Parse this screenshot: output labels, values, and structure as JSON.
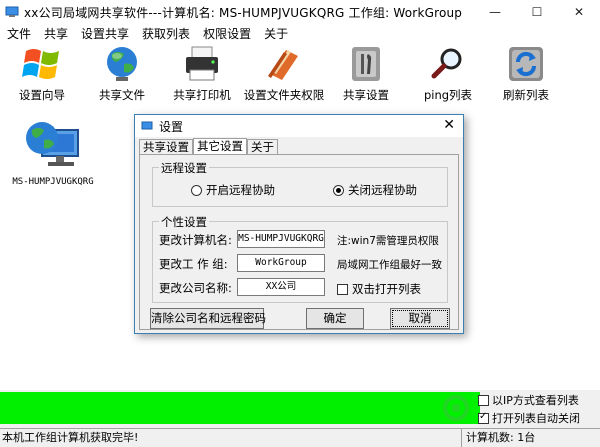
{
  "window": {
    "title": "xx公司局域网共享软件---计算机名: MS-HUMPJVUGKQRG  工作组: WorkGroup",
    "controls": [
      "—",
      "☐",
      "✕"
    ]
  },
  "menu": [
    "文件",
    "共享",
    "设置共享",
    "获取列表",
    "权限设置",
    "关于"
  ],
  "toolbar": [
    {
      "label": "设置向导",
      "icon": "windows-logo-icon"
    },
    {
      "label": "共享文件",
      "icon": "globe-icon"
    },
    {
      "label": "共享打印机",
      "icon": "printer-icon"
    },
    {
      "label": "设置文件夹权限",
      "icon": "books-icon"
    },
    {
      "label": "共享设置",
      "icon": "tools-icon"
    },
    {
      "label": "ping列表",
      "icon": "magnifier-icon"
    },
    {
      "label": "刷新列表",
      "icon": "refresh-icon"
    }
  ],
  "computers": [
    {
      "name": "MS-HUMPJVUGKQRG"
    }
  ],
  "dialog": {
    "title": "设置",
    "close": "✕",
    "tabs": [
      "共享设置",
      "其它设置",
      "关于"
    ],
    "active_tab": "其它设置",
    "remote_group": {
      "title": "远程设置",
      "options": [
        "开启远程协助",
        "关闭远程协助"
      ],
      "selected": "关闭远程协助"
    },
    "personal_group": {
      "title": "个性设置",
      "computer_name_label": "更改计算机名:",
      "computer_name_value": "MS-HUMPJVUGKQRG",
      "computer_name_note": "注:win7需管理员权限",
      "workgroup_label": "更改工 作 组:",
      "workgroup_value": "WorkGroup",
      "workgroup_note": "局域网工作组最好一致",
      "company_label": "更改公司名称:",
      "company_value": "XX公司",
      "dblclick_label": "双击打开列表"
    },
    "buttons": {
      "clear": "清除公司名和远程密码",
      "ok": "确定",
      "cancel": "取消"
    }
  },
  "options": {
    "ip_view": "以IP方式查看列表",
    "auto_close": "打开列表自动关闭"
  },
  "progress": {
    "fraction": 0.8,
    "color": "#00f000"
  },
  "status": {
    "left": "本机工作组计算机获取完毕!",
    "right": "计算机数: 1台"
  }
}
